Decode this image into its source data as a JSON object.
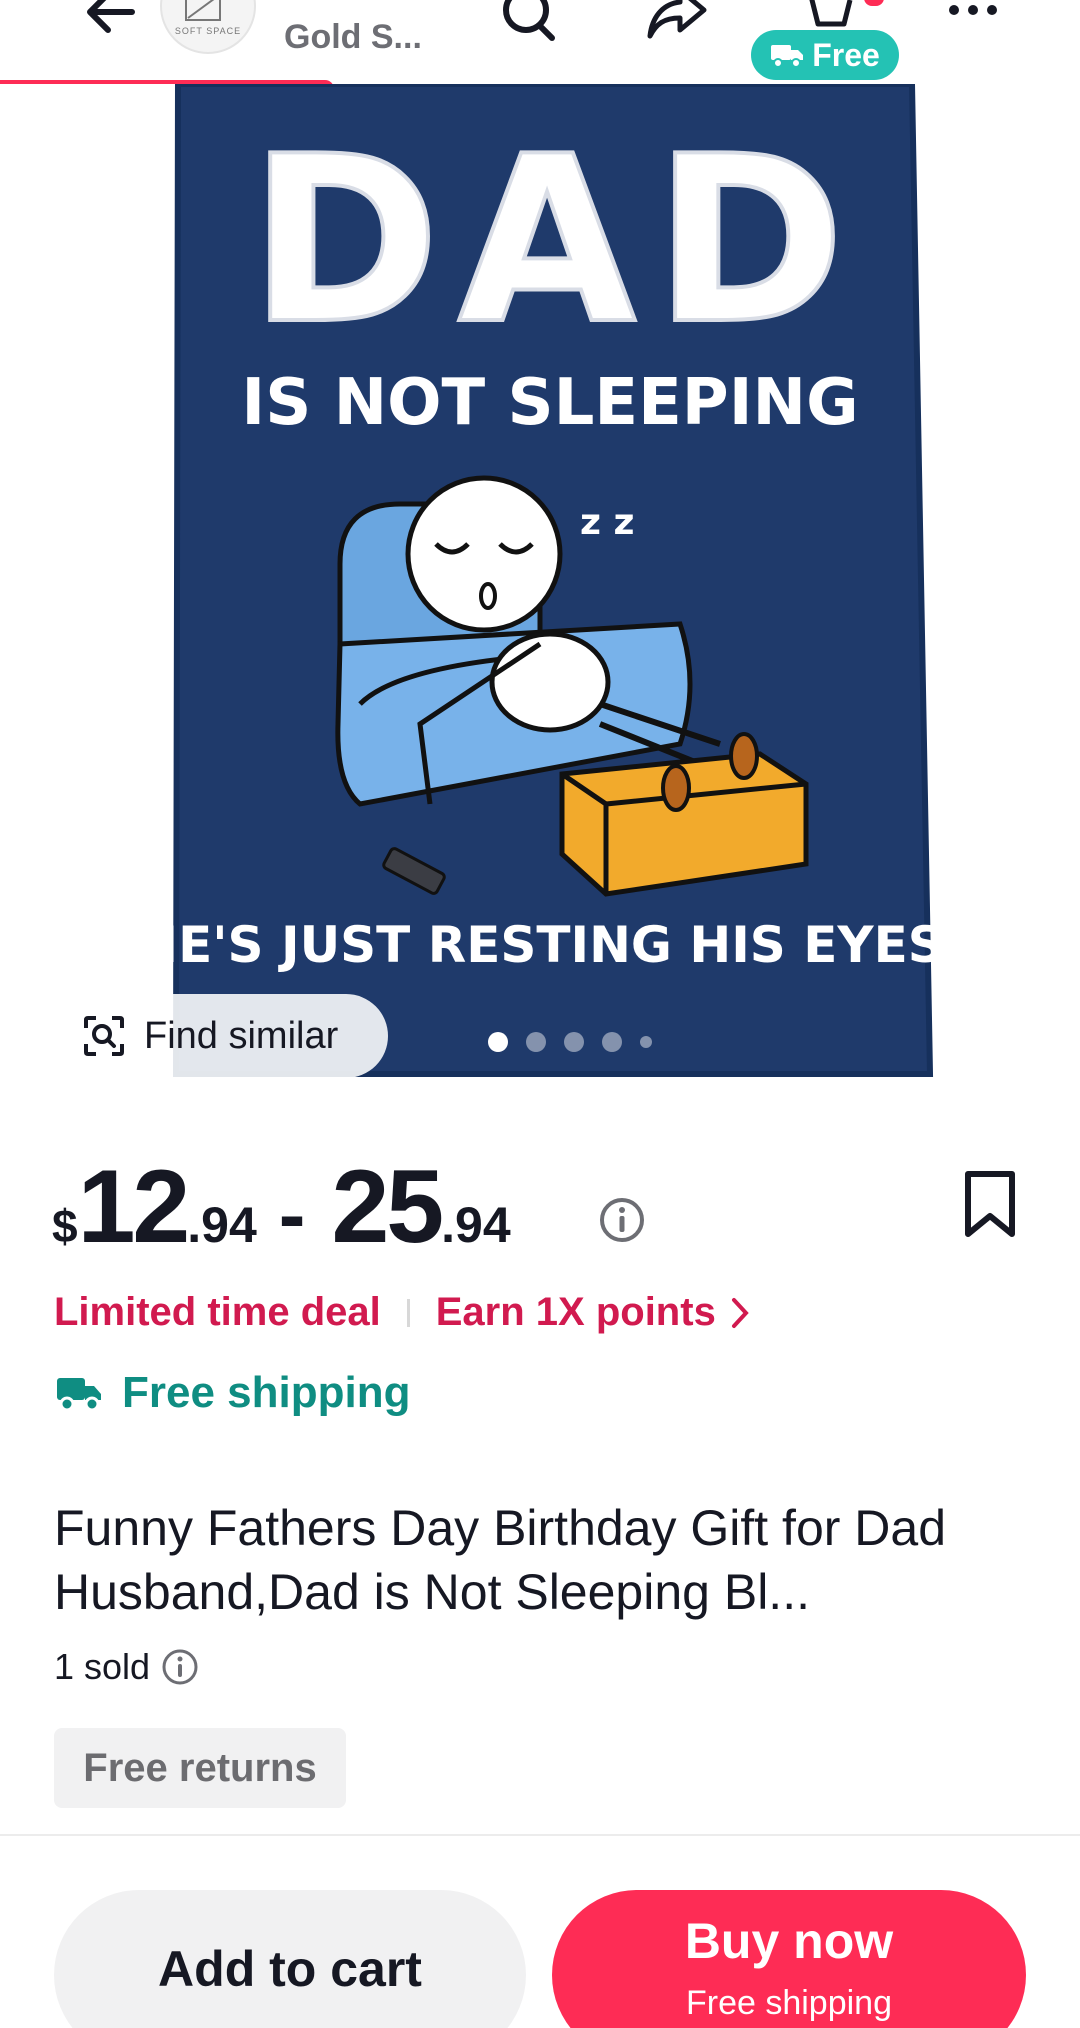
{
  "header": {
    "store_name": "Gold S...",
    "store_logo_text": "SOFT SPACE",
    "shipping_pill": "Free",
    "icons": [
      "back-arrow-icon",
      "search-icon",
      "share-icon",
      "cart-icon",
      "more-icon"
    ]
  },
  "product_image": {
    "headline": "DAD",
    "subline": "IS NOT SLEEPING",
    "zzz": "z z",
    "footer_text": "HE'S JUST RESTING HIS EYES",
    "find_similar": "Find similar",
    "slide_count": 5,
    "active_slide": 1
  },
  "price": {
    "currency": "$",
    "low_whole": "12",
    "low_cents": ".94",
    "separator": "-",
    "high_whole": "25",
    "high_cents": ".94"
  },
  "promo": {
    "deal": "Limited time deal",
    "points": "Earn 1X points"
  },
  "shipping": {
    "label": "Free shipping"
  },
  "product": {
    "title": "Funny Fathers Day Birthday Gift for Dad Husband,Dad is Not Sleeping Bl...",
    "sold": "1 sold",
    "returns": "Free returns"
  },
  "actions": {
    "add_to_cart": "Add to cart",
    "buy_now": "Buy now",
    "buy_now_sub": "Free shipping"
  },
  "colors": {
    "brand_red": "#fe2c55",
    "deal_red": "#d11a4f",
    "teal": "#0f8d82",
    "teal_pill": "#24c2b4",
    "blanket_navy": "#1f3a6b"
  }
}
